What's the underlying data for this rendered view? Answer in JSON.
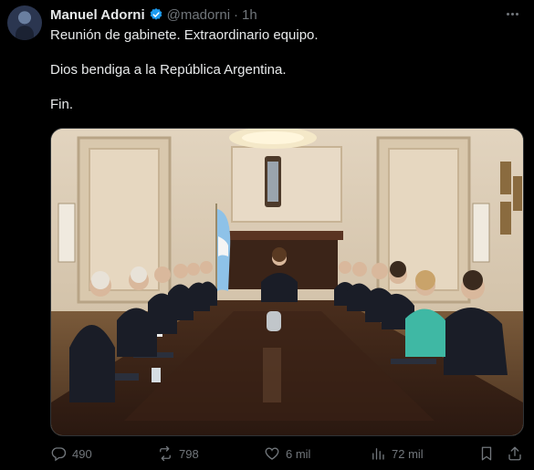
{
  "post": {
    "author_name": "Manuel Adorni",
    "handle": "@madorni",
    "separator": "·",
    "time": "1h",
    "text_lines": [
      "Reunión de gabinete. Extraordinario equipo.",
      "Dios bendiga a la República Argentina.",
      "Fin."
    ]
  },
  "actions": {
    "replies": "490",
    "reposts": "798",
    "likes": "6 mil",
    "views": "72 mil"
  },
  "icons": {
    "verified": "verified-badge-icon",
    "more": "more-options-icon",
    "reply": "reply-icon",
    "repost": "repost-icon",
    "like": "like-icon",
    "views": "views-icon",
    "bookmark": "bookmark-icon",
    "share": "share-icon"
  },
  "colors": {
    "background": "#000000",
    "text": "#e7e9ea",
    "secondary": "#71767b",
    "verified": "#1d9bf0"
  }
}
